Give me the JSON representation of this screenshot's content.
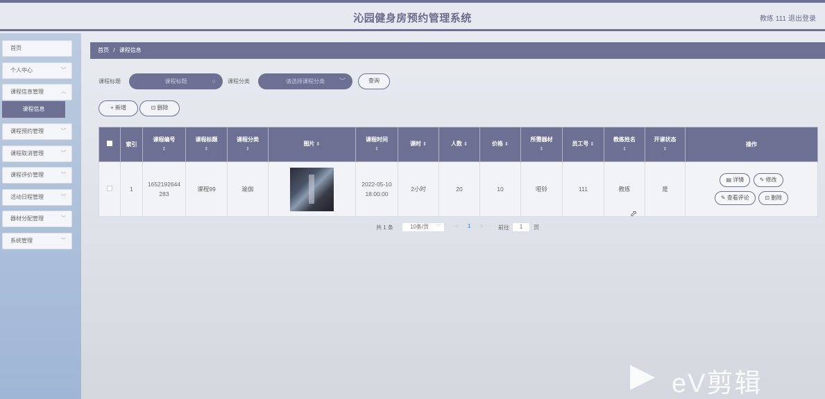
{
  "header": {
    "title": "沁园健身房预约管理系统",
    "user": "教练 111",
    "logout": "退出登录"
  },
  "sidebar": {
    "items": [
      {
        "label": "首页"
      },
      {
        "label": "个人中心"
      },
      {
        "label": "课程信息管理"
      },
      {
        "label": "课程信息"
      },
      {
        "label": "课程预约管理"
      },
      {
        "label": "课程取消管理"
      },
      {
        "label": "课程评价管理"
      },
      {
        "label": "活动日程管理"
      },
      {
        "label": "器材分配管理"
      },
      {
        "label": "系统管理"
      }
    ]
  },
  "breadcrumb": {
    "home": "首页",
    "sep": "/",
    "current": "课程信息"
  },
  "search": {
    "title_label": "课程标题",
    "title_placeholder": "课程标题",
    "category_label": "课程分类",
    "category_placeholder": "请选择课程分类",
    "query_button": "查询"
  },
  "toolbar": {
    "add": "+ 新增",
    "delete": "删除"
  },
  "table": {
    "columns": [
      "索引",
      "课程编号",
      "课程标题",
      "课程分类",
      "图片",
      "课程时间",
      "课时",
      "人数",
      "价格",
      "所需器材",
      "员工号",
      "教练姓名",
      "开课状态",
      "操作"
    ],
    "rows": [
      {
        "index": "1",
        "course_no": "1652192644283",
        "title": "课程99",
        "category": "瑜伽",
        "time": "2022-05-10 18:00:00",
        "hours": "2小时",
        "people": "20",
        "price": "10",
        "equipment": "哑铃",
        "staff_no": "111",
        "coach": "教练",
        "status": "是",
        "actions": {
          "detail": "详情",
          "edit": "修改",
          "review": "查看评论",
          "delete": "删除"
        }
      }
    ]
  },
  "pager": {
    "total": "共 1 条",
    "page_size": "10条/页",
    "prev": "<",
    "current": "1",
    "next": ">",
    "goto_label": "前往",
    "goto_value": "1",
    "page_suffix": "页"
  },
  "watermark": "eV剪辑",
  "icons": {
    "search": "search-icon",
    "chevron": "chevron-down-icon",
    "trash": "trash-icon",
    "doc": "document-icon",
    "edit": "edit-icon",
    "sort": "sort-icon"
  },
  "colors": {
    "accent": "#6e7093"
  }
}
